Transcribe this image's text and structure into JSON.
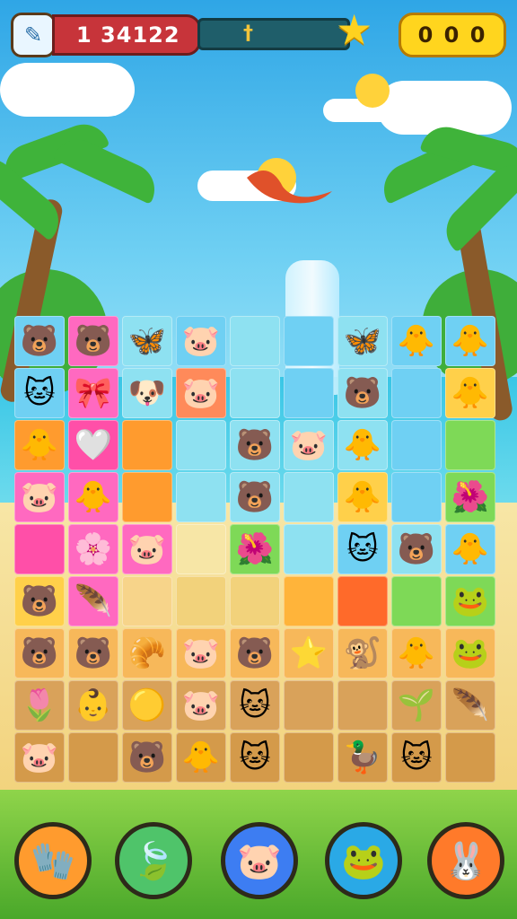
{
  "hud": {
    "tool_icon": "pencil-icon",
    "score": "1 34122",
    "progress_marker_icon": "dagger-icon",
    "star_icon": "star-icon",
    "coins": "0 0 0"
  },
  "board": {
    "tiles": [
      {
        "emoji": "🐻",
        "bg": "#6fd0f3"
      },
      {
        "emoji": "🐻",
        "bg": "#ff69c0"
      },
      {
        "emoji": "🦋",
        "bg": "#8ee1f1"
      },
      {
        "emoji": "🐷",
        "bg": "#6fd0f3"
      },
      {
        "emoji": "",
        "bg": "#8ee1f1"
      },
      {
        "emoji": "",
        "bg": "#6fd0f3"
      },
      {
        "emoji": "🦋",
        "bg": "#8ee1f1"
      },
      {
        "emoji": "🐥",
        "bg": "#6fd0f3"
      },
      {
        "emoji": "🐥",
        "bg": "#6fd0f3"
      },
      {
        "emoji": "🐱",
        "bg": "#6fd0f3"
      },
      {
        "emoji": "🎀",
        "bg": "#ff69c0"
      },
      {
        "emoji": "🐶",
        "bg": "#8ee1f1"
      },
      {
        "emoji": "🐷",
        "bg": "#ff8a5a"
      },
      {
        "emoji": "",
        "bg": "#8ee1f1"
      },
      {
        "emoji": "",
        "bg": "#6fd0f3"
      },
      {
        "emoji": "🐻",
        "bg": "#8ee1f1"
      },
      {
        "emoji": "",
        "bg": "#6fd0f3"
      },
      {
        "emoji": "🐥",
        "bg": "#ffd04a"
      },
      {
        "emoji": "🐥",
        "bg": "#ff9b2e"
      },
      {
        "emoji": "🤍",
        "bg": "#ff4fa8"
      },
      {
        "emoji": "",
        "bg": "#ff9b2e"
      },
      {
        "emoji": "",
        "bg": "#8ee1f1"
      },
      {
        "emoji": "🐻",
        "bg": "#8ee1f1"
      },
      {
        "emoji": "🐷",
        "bg": "#8ee1f1"
      },
      {
        "emoji": "🐥",
        "bg": "#8ee1f1"
      },
      {
        "emoji": "",
        "bg": "#6fd0f3"
      },
      {
        "emoji": "",
        "bg": "#7ed957"
      },
      {
        "emoji": "🐷",
        "bg": "#ff69c0"
      },
      {
        "emoji": "🐥",
        "bg": "#ff69c0"
      },
      {
        "emoji": "",
        "bg": "#ff9b2e"
      },
      {
        "emoji": "",
        "bg": "#8ee1f1"
      },
      {
        "emoji": "🐻",
        "bg": "#8ee1f1"
      },
      {
        "emoji": "",
        "bg": "#8ee1f1"
      },
      {
        "emoji": "🐥",
        "bg": "#ffd04a"
      },
      {
        "emoji": "",
        "bg": "#6fd0f3"
      },
      {
        "emoji": "🌺",
        "bg": "#7ed957"
      },
      {
        "emoji": "",
        "bg": "#ff4fa8"
      },
      {
        "emoji": "🌸",
        "bg": "#ff69c0"
      },
      {
        "emoji": "🐷",
        "bg": "#ff69c0"
      },
      {
        "emoji": "",
        "bg": "#f7e6a6"
      },
      {
        "emoji": "🌺",
        "bg": "#7ed957"
      },
      {
        "emoji": "",
        "bg": "#8ee1f1"
      },
      {
        "emoji": "🐱",
        "bg": "#6fd0f3"
      },
      {
        "emoji": "🐻",
        "bg": "#8ee1f1"
      },
      {
        "emoji": "🐥",
        "bg": "#6fd0f3"
      },
      {
        "emoji": "🐻",
        "bg": "#ffd04a"
      },
      {
        "emoji": "🪶",
        "bg": "#ff69c0"
      },
      {
        "emoji": "",
        "bg": "#f7d48a"
      },
      {
        "emoji": "",
        "bg": "#f2d27b"
      },
      {
        "emoji": "",
        "bg": "#f2d27b"
      },
      {
        "emoji": "",
        "bg": "#ffb43a"
      },
      {
        "emoji": "",
        "bg": "#ff6a2a"
      },
      {
        "emoji": "",
        "bg": "#7ed957"
      },
      {
        "emoji": "🐸",
        "bg": "#7ed957"
      },
      {
        "emoji": "🐻",
        "bg": "#f7b85a"
      },
      {
        "emoji": "🐻",
        "bg": "#f7b85a"
      },
      {
        "emoji": "🥐",
        "bg": "#f7b85a"
      },
      {
        "emoji": "🐷",
        "bg": "#f7b85a"
      },
      {
        "emoji": "🐻",
        "bg": "#f7b85a"
      },
      {
        "emoji": "⭐",
        "bg": "#f7b85a"
      },
      {
        "emoji": "🐒",
        "bg": "#f7b85a"
      },
      {
        "emoji": "🐥",
        "bg": "#f7b85a"
      },
      {
        "emoji": "🐸",
        "bg": "#f7b85a"
      },
      {
        "emoji": "🌷",
        "bg": "#d9a25a"
      },
      {
        "emoji": "👶",
        "bg": "#d9a25a"
      },
      {
        "emoji": "🟡",
        "bg": "#d9a25a"
      },
      {
        "emoji": "🐷",
        "bg": "#d9a25a"
      },
      {
        "emoji": "🐱",
        "bg": "#d9a25a"
      },
      {
        "emoji": "",
        "bg": "#d9a25a"
      },
      {
        "emoji": "",
        "bg": "#d9a25a"
      },
      {
        "emoji": "🌱",
        "bg": "#d9a25a"
      },
      {
        "emoji": "🪶",
        "bg": "#d9a25a"
      },
      {
        "emoji": "🐷",
        "bg": "#d49a4a"
      },
      {
        "emoji": "",
        "bg": "#d49a4a"
      },
      {
        "emoji": "🐻",
        "bg": "#d49a4a"
      },
      {
        "emoji": "🐥",
        "bg": "#d49a4a"
      },
      {
        "emoji": "🐱",
        "bg": "#d49a4a"
      },
      {
        "emoji": "",
        "bg": "#d49a4a"
      },
      {
        "emoji": "🦆",
        "bg": "#d49a4a"
      },
      {
        "emoji": "🐱",
        "bg": "#d49a4a"
      },
      {
        "emoji": "",
        "bg": "#d49a4a"
      }
    ]
  },
  "powerups": [
    {
      "name": "glove-powerup",
      "icon": "🧤",
      "bg": "#ff9b2e"
    },
    {
      "name": "leaf-powerup",
      "icon": "🍃",
      "bg": "#4fc46a"
    },
    {
      "name": "pig-powerup",
      "icon": "🐷",
      "bg": "#3d7df2"
    },
    {
      "name": "frog-powerup",
      "icon": "🐸",
      "bg": "#2aa9e6"
    },
    {
      "name": "bunny-powerup",
      "icon": "🐰",
      "bg": "#ff7a2a"
    }
  ]
}
